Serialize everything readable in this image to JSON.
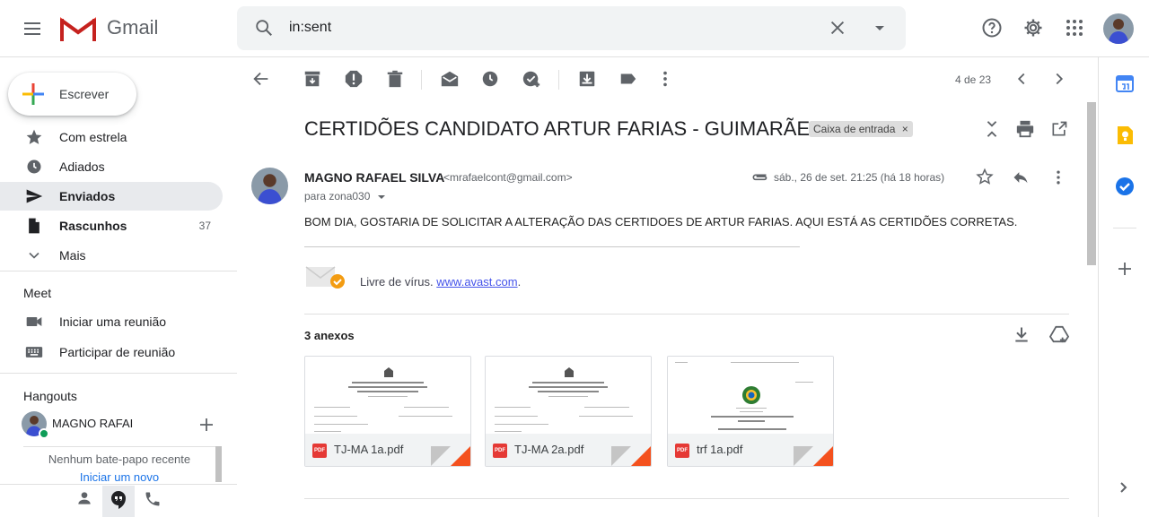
{
  "app": {
    "name": "Gmail"
  },
  "search": {
    "value": "in:sent"
  },
  "compose": {
    "label": "Escrever"
  },
  "sidebar": {
    "items": [
      {
        "label": "Com estrela",
        "icon": "star-icon",
        "count": ""
      },
      {
        "label": "Adiados",
        "icon": "clock-icon",
        "count": ""
      },
      {
        "label": "Enviados",
        "icon": "send-icon",
        "count": ""
      },
      {
        "label": "Rascunhos",
        "icon": "draft-icon",
        "count": "37"
      },
      {
        "label": "Mais",
        "icon": "chevron-down-icon",
        "count": ""
      }
    ],
    "meet": {
      "title": "Meet",
      "items": [
        {
          "label": "Iniciar uma reunião",
          "icon": "video-icon"
        },
        {
          "label": "Participar de reunião",
          "icon": "keyboard-icon"
        }
      ]
    },
    "hangouts": {
      "title": "Hangouts",
      "user": "MAGNO RAFAI",
      "empty_text": "Nenhum bate-papo recente",
      "start_link": "Iniciar um novo"
    }
  },
  "toolbar": {
    "page_count": "4 de 23"
  },
  "email": {
    "subject": "CERTIDÕES CANDIDATO ARTUR FARIAS - GUIMARÃES",
    "label_chip": "Caixa de entrada",
    "label_chip_close": "×",
    "sender_name": "MAGNO RAFAEL SILVA",
    "sender_email": "<mrafaelcont@gmail.com>",
    "recipients": "para zona030",
    "date": "sáb., 26 de set. 21:25 (há 18 horas)",
    "body": "BOM DIA, GOSTARIA DE SOLICITAR A ALTERAÇÃO DAS CERTIDOES DE ARTUR FARIAS. AQUI ESTÁ AS CERTIDÕES CORRETAS.",
    "signature_text": "Livre de vírus. ",
    "signature_link": "www.avast.com",
    "signature_dot": "."
  },
  "attachments": {
    "title": "3 anexos",
    "files": [
      {
        "name": "TJ-MA 1a.pdf",
        "type": "PDF"
      },
      {
        "name": "TJ-MA 2a.pdf",
        "type": "PDF"
      },
      {
        "name": "trf 1a.pdf",
        "type": "PDF"
      }
    ]
  },
  "colors": {
    "accent_active": "#e8eaed",
    "pdf_red": "#e53935",
    "link": "#4453ea",
    "status_online": "#0f9d58"
  }
}
